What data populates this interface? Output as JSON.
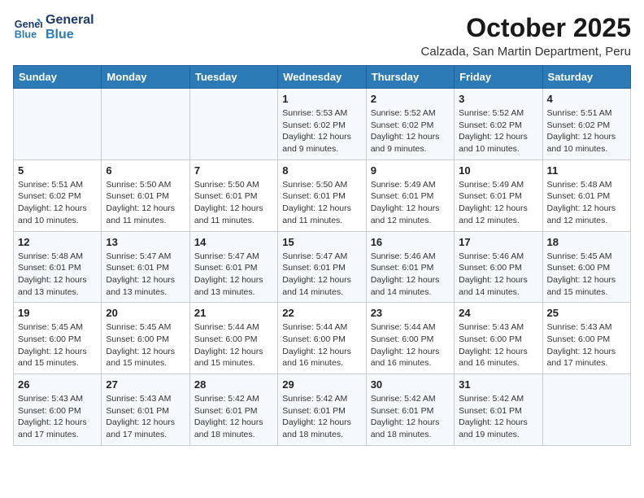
{
  "header": {
    "logo_line1": "General",
    "logo_line2": "Blue",
    "month": "October 2025",
    "location": "Calzada, San Martin Department, Peru"
  },
  "weekdays": [
    "Sunday",
    "Monday",
    "Tuesday",
    "Wednesday",
    "Thursday",
    "Friday",
    "Saturday"
  ],
  "weeks": [
    [
      {
        "day": "",
        "info": ""
      },
      {
        "day": "",
        "info": ""
      },
      {
        "day": "",
        "info": ""
      },
      {
        "day": "1",
        "info": "Sunrise: 5:53 AM\nSunset: 6:02 PM\nDaylight: 12 hours and 9 minutes."
      },
      {
        "day": "2",
        "info": "Sunrise: 5:52 AM\nSunset: 6:02 PM\nDaylight: 12 hours and 9 minutes."
      },
      {
        "day": "3",
        "info": "Sunrise: 5:52 AM\nSunset: 6:02 PM\nDaylight: 12 hours and 10 minutes."
      },
      {
        "day": "4",
        "info": "Sunrise: 5:51 AM\nSunset: 6:02 PM\nDaylight: 12 hours and 10 minutes."
      }
    ],
    [
      {
        "day": "5",
        "info": "Sunrise: 5:51 AM\nSunset: 6:02 PM\nDaylight: 12 hours and 10 minutes."
      },
      {
        "day": "6",
        "info": "Sunrise: 5:50 AM\nSunset: 6:01 PM\nDaylight: 12 hours and 11 minutes."
      },
      {
        "day": "7",
        "info": "Sunrise: 5:50 AM\nSunset: 6:01 PM\nDaylight: 12 hours and 11 minutes."
      },
      {
        "day": "8",
        "info": "Sunrise: 5:50 AM\nSunset: 6:01 PM\nDaylight: 12 hours and 11 minutes."
      },
      {
        "day": "9",
        "info": "Sunrise: 5:49 AM\nSunset: 6:01 PM\nDaylight: 12 hours and 12 minutes."
      },
      {
        "day": "10",
        "info": "Sunrise: 5:49 AM\nSunset: 6:01 PM\nDaylight: 12 hours and 12 minutes."
      },
      {
        "day": "11",
        "info": "Sunrise: 5:48 AM\nSunset: 6:01 PM\nDaylight: 12 hours and 12 minutes."
      }
    ],
    [
      {
        "day": "12",
        "info": "Sunrise: 5:48 AM\nSunset: 6:01 PM\nDaylight: 12 hours and 13 minutes."
      },
      {
        "day": "13",
        "info": "Sunrise: 5:47 AM\nSunset: 6:01 PM\nDaylight: 12 hours and 13 minutes."
      },
      {
        "day": "14",
        "info": "Sunrise: 5:47 AM\nSunset: 6:01 PM\nDaylight: 12 hours and 13 minutes."
      },
      {
        "day": "15",
        "info": "Sunrise: 5:47 AM\nSunset: 6:01 PM\nDaylight: 12 hours and 14 minutes."
      },
      {
        "day": "16",
        "info": "Sunrise: 5:46 AM\nSunset: 6:01 PM\nDaylight: 12 hours and 14 minutes."
      },
      {
        "day": "17",
        "info": "Sunrise: 5:46 AM\nSunset: 6:00 PM\nDaylight: 12 hours and 14 minutes."
      },
      {
        "day": "18",
        "info": "Sunrise: 5:45 AM\nSunset: 6:00 PM\nDaylight: 12 hours and 15 minutes."
      }
    ],
    [
      {
        "day": "19",
        "info": "Sunrise: 5:45 AM\nSunset: 6:00 PM\nDaylight: 12 hours and 15 minutes."
      },
      {
        "day": "20",
        "info": "Sunrise: 5:45 AM\nSunset: 6:00 PM\nDaylight: 12 hours and 15 minutes."
      },
      {
        "day": "21",
        "info": "Sunrise: 5:44 AM\nSunset: 6:00 PM\nDaylight: 12 hours and 15 minutes."
      },
      {
        "day": "22",
        "info": "Sunrise: 5:44 AM\nSunset: 6:00 PM\nDaylight: 12 hours and 16 minutes."
      },
      {
        "day": "23",
        "info": "Sunrise: 5:44 AM\nSunset: 6:00 PM\nDaylight: 12 hours and 16 minutes."
      },
      {
        "day": "24",
        "info": "Sunrise: 5:43 AM\nSunset: 6:00 PM\nDaylight: 12 hours and 16 minutes."
      },
      {
        "day": "25",
        "info": "Sunrise: 5:43 AM\nSunset: 6:00 PM\nDaylight: 12 hours and 17 minutes."
      }
    ],
    [
      {
        "day": "26",
        "info": "Sunrise: 5:43 AM\nSunset: 6:00 PM\nDaylight: 12 hours and 17 minutes."
      },
      {
        "day": "27",
        "info": "Sunrise: 5:43 AM\nSunset: 6:01 PM\nDaylight: 12 hours and 17 minutes."
      },
      {
        "day": "28",
        "info": "Sunrise: 5:42 AM\nSunset: 6:01 PM\nDaylight: 12 hours and 18 minutes."
      },
      {
        "day": "29",
        "info": "Sunrise: 5:42 AM\nSunset: 6:01 PM\nDaylight: 12 hours and 18 minutes."
      },
      {
        "day": "30",
        "info": "Sunrise: 5:42 AM\nSunset: 6:01 PM\nDaylight: 12 hours and 18 minutes."
      },
      {
        "day": "31",
        "info": "Sunrise: 5:42 AM\nSunset: 6:01 PM\nDaylight: 12 hours and 19 minutes."
      },
      {
        "day": "",
        "info": ""
      }
    ]
  ]
}
